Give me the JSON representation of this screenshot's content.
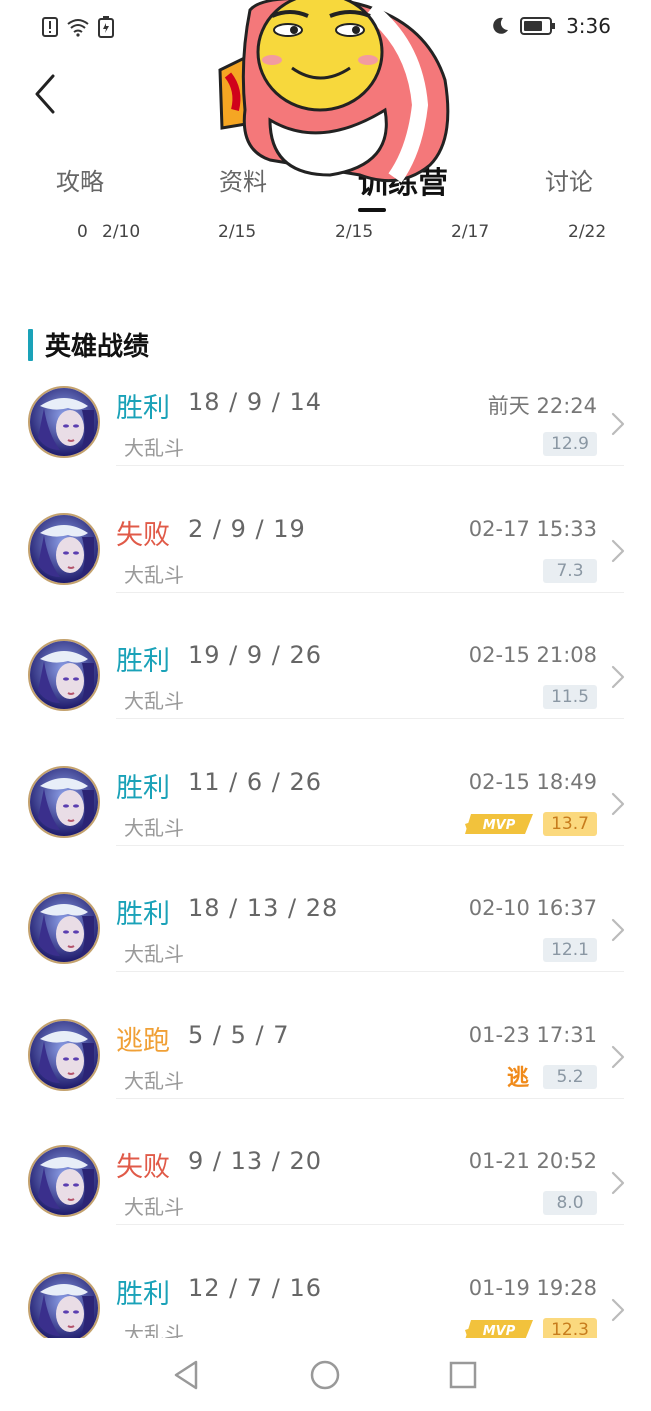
{
  "status_bar": {
    "time": "3:36"
  },
  "tabs": [
    {
      "label": "攻略",
      "active": false
    },
    {
      "label": "资料",
      "active": false
    },
    {
      "label": "训练营",
      "active": true
    },
    {
      "label": "讨论",
      "active": false
    }
  ],
  "date_axis": {
    "zero": "0",
    "ticks": [
      "2/10",
      "2/15",
      "2/15",
      "2/17",
      "2/22"
    ]
  },
  "section": {
    "title": "英雄战绩"
  },
  "matches": [
    {
      "result": "胜利",
      "type": "win",
      "kda": "18 / 9 / 14",
      "mode": "大乱斗",
      "datetime": "前天 22:24",
      "score": "12.9",
      "badge": ""
    },
    {
      "result": "失败",
      "type": "loss",
      "kda": "2 / 9 / 19",
      "mode": "大乱斗",
      "datetime": "02-17 15:33",
      "score": "7.3",
      "badge": ""
    },
    {
      "result": "胜利",
      "type": "win",
      "kda": "19 / 9 / 26",
      "mode": "大乱斗",
      "datetime": "02-15 21:08",
      "score": "11.5",
      "badge": ""
    },
    {
      "result": "胜利",
      "type": "win",
      "kda": "11 / 6 / 26",
      "mode": "大乱斗",
      "datetime": "02-15 18:49",
      "score": "13.7",
      "badge": "MVP"
    },
    {
      "result": "胜利",
      "type": "win",
      "kda": "18 / 13 / 28",
      "mode": "大乱斗",
      "datetime": "02-10 16:37",
      "score": "12.1",
      "badge": ""
    },
    {
      "result": "逃跑",
      "type": "escape",
      "kda": "5 / 5 / 7",
      "mode": "大乱斗",
      "datetime": "01-23 17:31",
      "score": "5.2",
      "badge": "escape"
    },
    {
      "result": "失败",
      "type": "loss",
      "kda": "9 / 13 / 20",
      "mode": "大乱斗",
      "datetime": "01-21 20:52",
      "score": "8.0",
      "badge": ""
    },
    {
      "result": "胜利",
      "type": "win",
      "kda": "12 / 7 / 16",
      "mode": "大乱斗",
      "datetime": "01-19 19:28",
      "score": "12.3",
      "badge": "MVP"
    }
  ],
  "mvp_badge_text": "MVP",
  "escape_badge_text": "逃",
  "colors": {
    "win": "#1aa2b8",
    "loss": "#e05a48",
    "escape": "#f0a036",
    "accent": "#1aa2b8"
  },
  "icons": [
    "alert-icon",
    "wifi-icon",
    "battery-charging-icon",
    "moon-icon",
    "battery-icon",
    "back-arrow-icon",
    "chevron-right-icon",
    "nav-back-icon",
    "nav-home-icon",
    "nav-recents-icon"
  ]
}
